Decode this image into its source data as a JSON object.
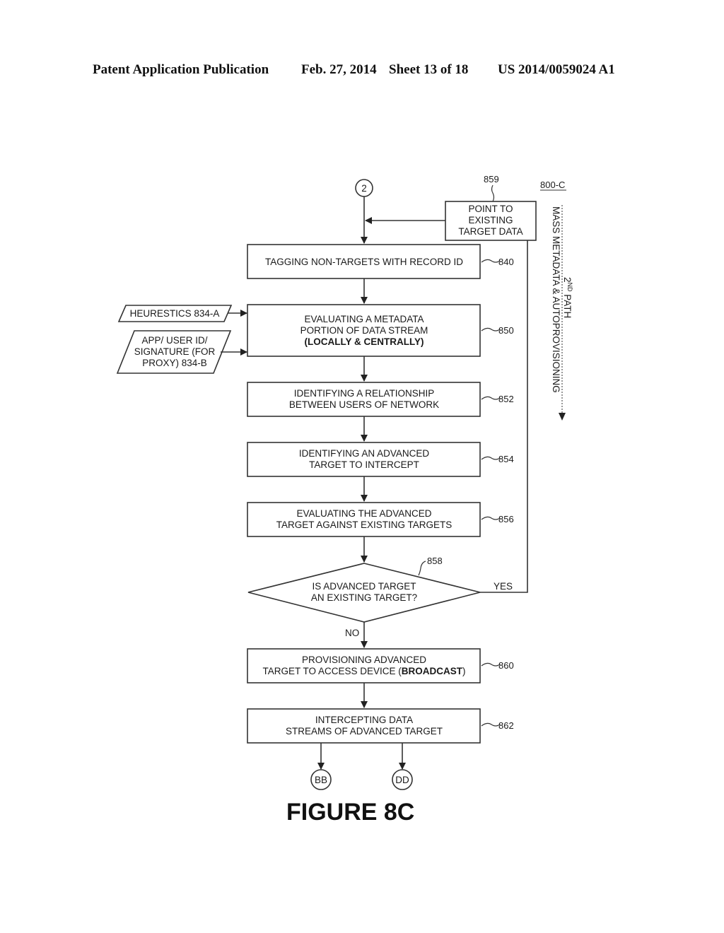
{
  "header": {
    "publication": "Patent Application Publication",
    "date": "Feb. 27, 2014",
    "sheet": "Sheet 13 of 18",
    "patent_number": "US 2014/0059024 A1"
  },
  "figure": {
    "id": "800-C",
    "title": "FIGURE 8C",
    "connectors": {
      "start": "2",
      "end_left": "BB",
      "end_right": "DD"
    },
    "side_annotation": {
      "line1_prefix": "2",
      "line1_sup": "ND",
      "line1_suffix": " PATH",
      "line2": "MASS METADATA & AUTOPROVISIONING"
    },
    "inputs": [
      {
        "ref": "834-A",
        "lines": [
          "HEURESTICS 834-A"
        ]
      },
      {
        "ref": "834-B",
        "lines": [
          "APP/ USER ID/",
          "SIGNATURE (FOR",
          "PROXY) 834-B"
        ]
      }
    ],
    "point_box": {
      "ref": "859",
      "lines": [
        "POINT TO",
        "EXISTING",
        "TARGET DATA"
      ]
    },
    "steps": [
      {
        "ref": "840",
        "lines": [
          "TAGGING NON-TARGETS WITH RECORD ID"
        ]
      },
      {
        "ref": "850",
        "lines": [
          "EVALUATING A METADATA",
          "PORTION OF DATA STREAM"
        ],
        "bold_line": "(LOCALLY & CENTRALLY)"
      },
      {
        "ref": "852",
        "lines": [
          "IDENTIFYING A RELATIONSHIP",
          "BETWEEN USERS OF NETWORK"
        ]
      },
      {
        "ref": "854",
        "lines": [
          "IDENTIFYING AN ADVANCED",
          "TARGET TO INTERCEPT"
        ]
      },
      {
        "ref": "856",
        "lines": [
          "EVALUATING THE ADVANCED",
          "TARGET AGAINST EXISTING TARGETS"
        ]
      }
    ],
    "decision": {
      "ref": "858",
      "lines": [
        "IS ADVANCED TARGET",
        "AN EXISTING TARGET?"
      ],
      "yes_label": "YES",
      "no_label": "NO"
    },
    "steps_after": [
      {
        "ref": "860",
        "line1": "PROVISIONING ADVANCED",
        "line2_pre": "TARGET TO ACCESS DEVICE (",
        "line2_bold": "BROADCAST",
        "line2_post": ")"
      },
      {
        "ref": "862",
        "lines": [
          "INTERCEPTING DATA",
          "STREAMS OF ADVANCED TARGET"
        ]
      }
    ]
  }
}
